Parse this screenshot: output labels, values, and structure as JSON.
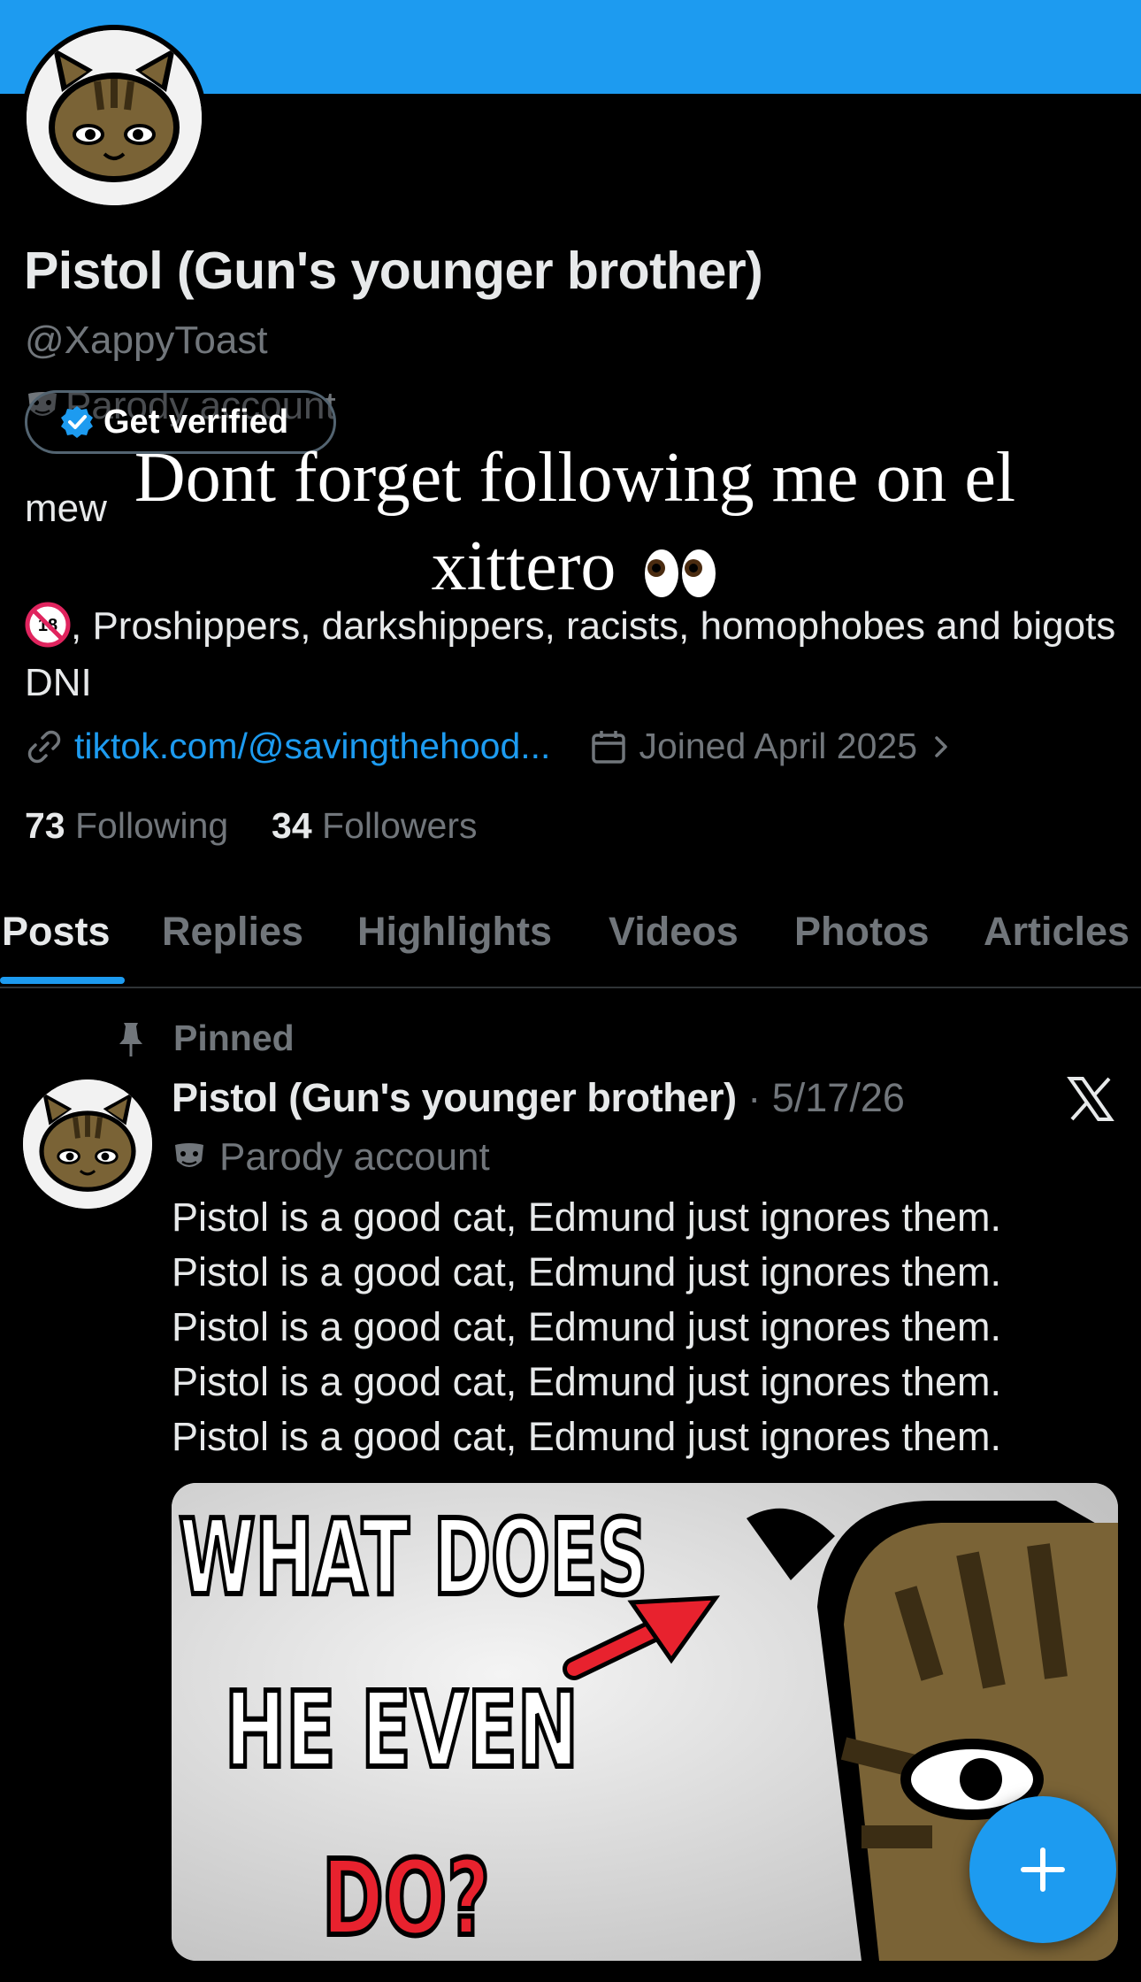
{
  "profile": {
    "display_name": "Pistol (Gun's younger brother)",
    "handle": "@XappyToast",
    "parody_label": "Parody account",
    "get_verified": "Get verified",
    "bio_mew": "mew",
    "overlay_text": "Dont forget following me on el xittero",
    "bio_dni": ", Proshippers, darkshippers, racists, homophobes and bigots DNI",
    "link": "tiktok.com/@savingthehood...",
    "joined": "Joined April 2025",
    "following_count": "73",
    "following_label": "Following",
    "followers_count": "34",
    "followers_label": "Followers"
  },
  "tabs": [
    {
      "label": "Posts",
      "active": true
    },
    {
      "label": "Replies",
      "active": false
    },
    {
      "label": "Highlights",
      "active": false
    },
    {
      "label": "Videos",
      "active": false
    },
    {
      "label": "Photos",
      "active": false
    },
    {
      "label": "Articles",
      "active": false
    }
  ],
  "post": {
    "pinned_label": "Pinned",
    "author": "Pistol (Gun's younger brother)",
    "separator": " · ",
    "date": "5/17/26",
    "parody_label": "Parody account",
    "lines": [
      "Pistol is a good cat, Edmund just ignores them.",
      "Pistol is a good cat, Edmund just ignores them.",
      "Pistol is a good cat, Edmund just ignores them.",
      "Pistol is a good cat, Edmund just ignores them.",
      "Pistol is a good cat, Edmund just ignores them."
    ],
    "media_text": {
      "line1": "WHAT DOES",
      "line2": "HE EVEN",
      "line3": "DO?"
    }
  },
  "icons": {
    "link": "link-icon",
    "calendar": "calendar-icon",
    "chevron": "chevron-right-icon",
    "pin": "pin-icon",
    "mask": "theater-mask-icon",
    "verified": "verified-badge-icon",
    "x_logo": "x-logo-icon",
    "compose": "plus-icon"
  },
  "colors": {
    "accent": "#1d9bf0",
    "background": "#000000",
    "text_primary": "#e7e9ea",
    "text_secondary": "#71767b"
  }
}
